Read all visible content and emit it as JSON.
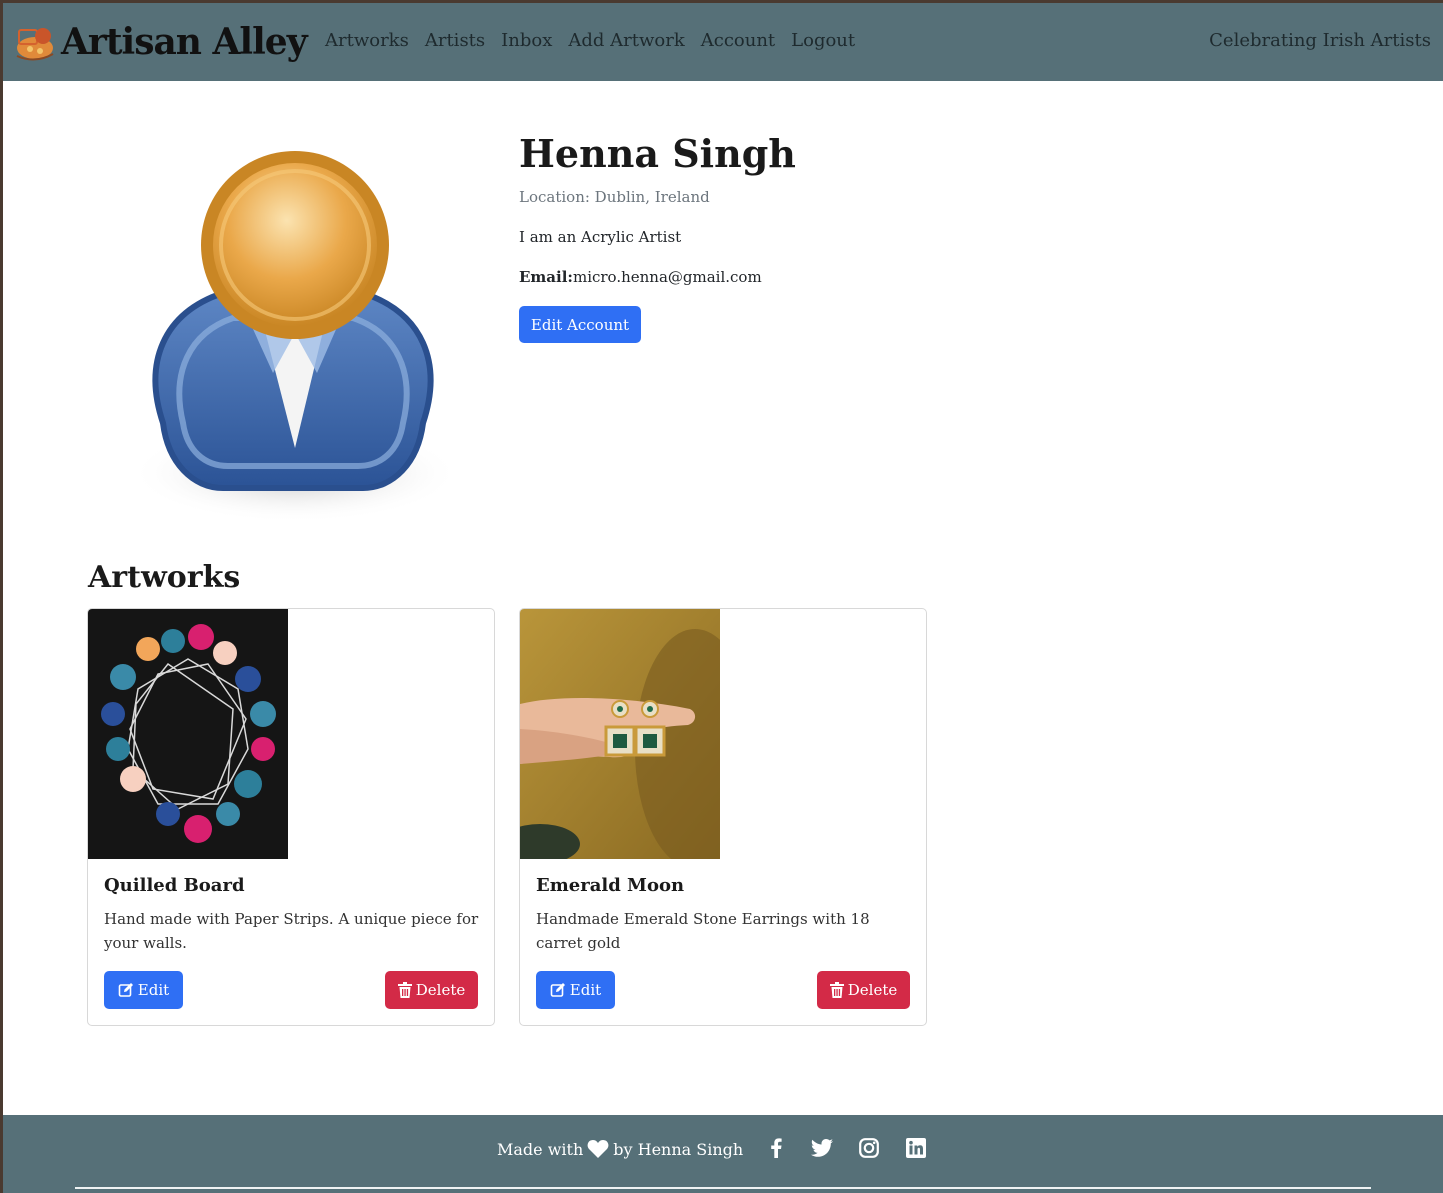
{
  "nav": {
    "brand": "Artisan Alley",
    "links": [
      "Artworks",
      "Artists",
      "Inbox",
      "Add Artwork",
      "Account",
      "Logout"
    ],
    "tagline": "Celebrating Irish Artists"
  },
  "profile": {
    "name": "Henna Singh",
    "location": "Location: Dublin, Ireland",
    "bio": "I am an Acrylic Artist",
    "email_label": "Email:",
    "email": "micro.henna@gmail.com",
    "edit_account_label": "Edit Account"
  },
  "artworks": {
    "heading": "Artworks",
    "items": [
      {
        "title": "Quilled Board",
        "description": "Hand made with Paper Strips. A unique piece for your walls.",
        "edit_label": "Edit",
        "delete_label": "Delete"
      },
      {
        "title": "Emerald Moon",
        "description": "Handmade Emerald Stone Earrings with 18 carret gold",
        "edit_label": "Edit",
        "delete_label": "Delete"
      }
    ]
  },
  "footer": {
    "made_with": "Made with",
    "by": "by Henna Singh",
    "social_icons": [
      "facebook-icon",
      "twitter-icon",
      "instagram-icon",
      "linkedin-icon"
    ]
  },
  "colors": {
    "navbar": "#567078",
    "primary": "#2f6ff4",
    "danger": "#d32a47"
  }
}
